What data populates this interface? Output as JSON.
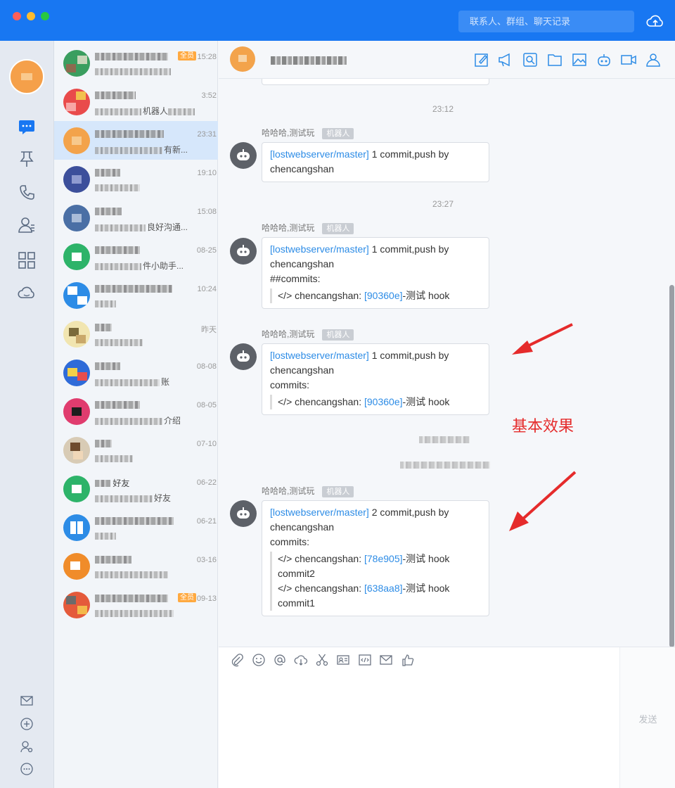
{
  "window": {
    "search_placeholder": "联系人、群组、聊天记录"
  },
  "conversations": [
    {
      "time": "15:28",
      "badge": "全员"
    },
    {
      "time": "3:52",
      "preview_tail": "机器人"
    },
    {
      "time": "23:31",
      "preview_tail": "有新..."
    },
    {
      "time": "19:10"
    },
    {
      "time": "15:08",
      "preview_tail": "良好沟通..."
    },
    {
      "time": "08-25",
      "preview_tail": "件小助手..."
    },
    {
      "time": "10:24"
    },
    {
      "time": "昨天"
    },
    {
      "time": "08-08",
      "preview_tail": "账"
    },
    {
      "time": "08-05",
      "preview_tail": "介绍"
    },
    {
      "time": "07-10"
    },
    {
      "time": "06-22",
      "name_tail": "好友",
      "preview_tail": "好友"
    },
    {
      "time": "06-21"
    },
    {
      "time": "03-16"
    },
    {
      "time": "09-13",
      "badge": "全员"
    }
  ],
  "chat": {
    "timestamps": [
      "23:12",
      "23:27"
    ],
    "sender": "哈哈哈,测试玩",
    "robot_tag": "机器人",
    "messages": [
      {
        "repo": "[lostwebserver/master]",
        "summary": " 1 commit,push by",
        "author": "chencangshan"
      },
      {
        "repo": "[lostwebserver/master]",
        "summary": " 1 commit,push by",
        "author": "chencangshan",
        "heading": "##commits:",
        "commit_prefix": "</> chencangshan: ",
        "commit_hash": "[90360e]",
        "commit_msg": "-测试 hook"
      },
      {
        "repo": "[lostwebserver/master]",
        "summary": " 1 commit,push by",
        "author": "chencangshan",
        "heading": "commits:",
        "commit_prefix": "</> chencangshan: ",
        "commit_hash": "[90360e]",
        "commit_msg": "-测试 hook"
      },
      {
        "repo": "[lostwebserver/master]",
        "summary": " 2 commit,push by",
        "author": "chencangshan",
        "heading": "commits:",
        "commits": [
          {
            "prefix": "</> chencangshan: ",
            "hash": "[78e905]",
            "msg": "-测试 hook",
            "body": "commit2"
          },
          {
            "prefix": "</> chencangshan: ",
            "hash": "[638aa8]",
            "msg": "-测试 hook",
            "body": "commit1"
          }
        ]
      }
    ]
  },
  "annotation": {
    "text": "基本效果",
    "color": "#e52b2b"
  },
  "composer": {
    "send_label": "发送"
  },
  "colors": {
    "brand": "#1877f2",
    "link": "#2d8ce6",
    "badge": "#ffa940"
  }
}
